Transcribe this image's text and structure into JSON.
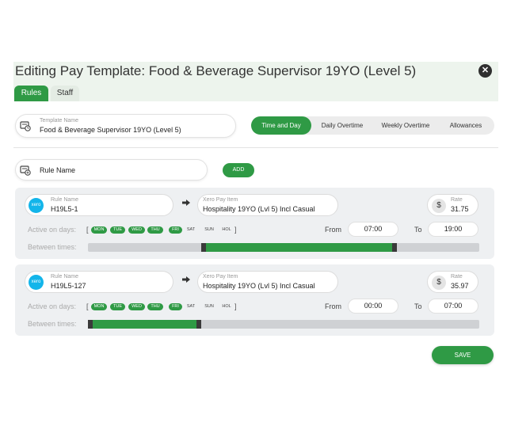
{
  "header": {
    "title": "Editing Pay Template: Food & Beverage Supervisor 19YO (Level 5)",
    "close_glyph": "✕",
    "tabs": [
      {
        "label": "Rules",
        "active": true
      },
      {
        "label": "Staff",
        "active": false
      }
    ]
  },
  "template": {
    "label": "Template Name",
    "value": "Food & Beverage Supervisor 19YO (Level 5)",
    "icon": "template-clock-icon"
  },
  "sections": [
    {
      "label": "Time and Day",
      "active": true
    },
    {
      "label": "Daily Overtime",
      "active": false
    },
    {
      "label": "Weekly Overtime",
      "active": false
    },
    {
      "label": "Allowances",
      "active": false
    }
  ],
  "new_rule": {
    "placeholder": "Rule Name",
    "add_label": "ADD"
  },
  "labels": {
    "rule_name": "Rule Name",
    "xero_pay_item": "Xero Pay Item",
    "rate": "Rate",
    "active_on_days": "Active on days:",
    "between_times": "Between times:",
    "from": "From",
    "to": "To",
    "bracket_open": "[",
    "bracket_close": "]",
    "xero_badge": "xero",
    "dollar": "$",
    "arrow_glyph": "➡"
  },
  "rules": [
    {
      "name": "H19L5-1",
      "pay_item": "Hospitality 19YO (Lvl 5) Incl Casual",
      "rate": "31.75",
      "days": [
        {
          "label": "MON",
          "active": true
        },
        {
          "label": "TUE",
          "active": true
        },
        {
          "label": "WED",
          "active": true
        },
        {
          "label": "THU",
          "active": true
        },
        {
          "label": "FRI",
          "active": true
        },
        {
          "label": "SAT",
          "active": false
        },
        {
          "label": "SUN",
          "active": false
        },
        {
          "label": "HOL",
          "active": false
        }
      ],
      "from": "07:00",
      "to": "19:00",
      "range_fraction": [
        0.29,
        0.79
      ]
    },
    {
      "name": "H19L5-127",
      "pay_item": "Hospitality 19YO (Lvl 5) Incl Casual",
      "rate": "35.97",
      "days": [
        {
          "label": "MON",
          "active": true
        },
        {
          "label": "TUE",
          "active": true
        },
        {
          "label": "WED",
          "active": true
        },
        {
          "label": "THU",
          "active": true
        },
        {
          "label": "FRI",
          "active": true
        },
        {
          "label": "SAT",
          "active": false
        },
        {
          "label": "SUN",
          "active": false
        },
        {
          "label": "HOL",
          "active": false
        }
      ],
      "from": "00:00",
      "to": "07:00",
      "range_fraction": [
        0.0,
        0.29
      ]
    }
  ],
  "footer": {
    "save_label": "SAVE"
  },
  "colors": {
    "accent": "#2f9a45",
    "xero": "#13b5ea",
    "track": "#cfd1d4"
  }
}
